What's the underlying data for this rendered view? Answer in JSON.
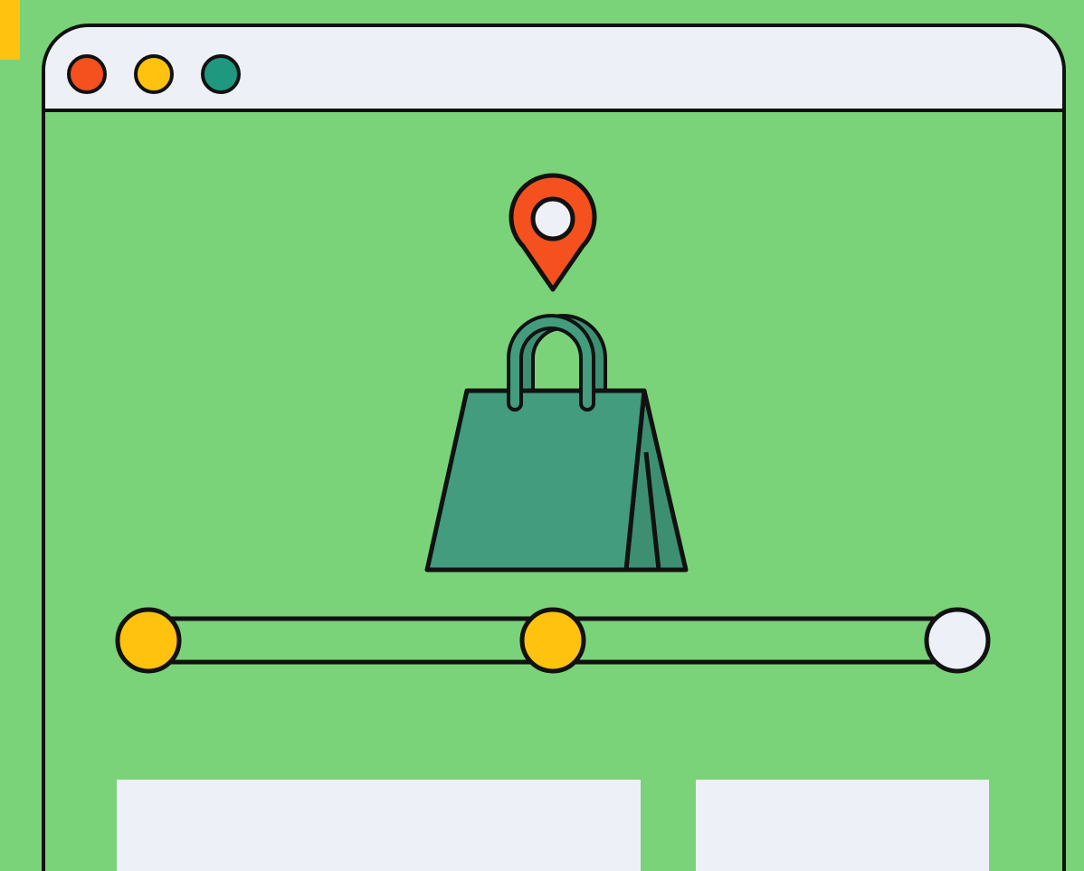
{
  "colors": {
    "background": "#7AD378",
    "window_chrome": "#EEF0F8",
    "outline": "#111111",
    "corner_tab": "#FFC20E",
    "dot_close": "#F4511E",
    "dot_minimize": "#FFC20E",
    "dot_maximize": "#1E9980",
    "location_pin": "#F4511E",
    "bag": "#429C7D",
    "bag_side": "#3D8F72",
    "progress_done": "#FFC20E",
    "progress_todo": "#EEF0F8"
  },
  "window": {
    "controls": [
      "close-dot",
      "minimize-dot",
      "maximize-dot"
    ]
  },
  "illustration": {
    "top_icon": "location-pin-icon",
    "main_icon": "shopping-bag-icon"
  },
  "progress": {
    "steps_total": 3,
    "steps_completed": 2,
    "step_states": [
      "done",
      "done",
      "pending"
    ]
  },
  "content_cards": 2
}
